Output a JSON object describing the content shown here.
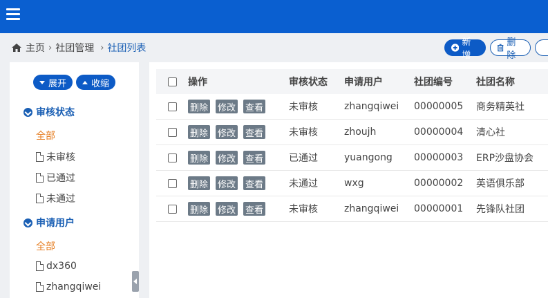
{
  "breadcrumb": {
    "home": "主页",
    "manage": "社团管理",
    "list": "社团列表"
  },
  "actions": {
    "add": "新增",
    "delete": "删除"
  },
  "sidebar": {
    "expand": "展开",
    "collapse": "收缩",
    "groups": [
      {
        "title": "审核状态",
        "items": [
          "全部",
          "未审核",
          "已通过",
          "未通过"
        ]
      },
      {
        "title": "申请用户",
        "items": [
          "全部",
          "dx360",
          "zhangqiwei"
        ]
      }
    ]
  },
  "table": {
    "headers": {
      "ops": "操作",
      "status": "审核状态",
      "user": "申请用户",
      "no": "社团编号",
      "name": "社团名称"
    },
    "ops": {
      "delete": "删除",
      "edit": "修改",
      "view": "查看"
    },
    "rows": [
      {
        "status": "未审核",
        "user": "zhangqiwei",
        "no": "00000005",
        "name": "商务精英社"
      },
      {
        "status": "未审核",
        "user": "zhoujh",
        "no": "00000004",
        "name": "清心社"
      },
      {
        "status": "已通过",
        "user": "yuangong",
        "no": "00000003",
        "name": "ERP沙盘协会"
      },
      {
        "status": "未通过",
        "user": "wxg",
        "no": "00000002",
        "name": "英语俱乐部"
      },
      {
        "status": "未审核",
        "user": "zhangqiwei",
        "no": "00000001",
        "name": "先锋队社团"
      }
    ]
  },
  "colors": {
    "topbar": "#0a5fd0",
    "accent": "#1a5fb4",
    "active_item": "#e67e22",
    "op_button": "#6c7a87"
  },
  "icons": {
    "menu": "hamburger-icon",
    "home": "home-icon",
    "add": "plus-circle-icon",
    "delete": "trash-icon",
    "file": "doc-icon"
  }
}
